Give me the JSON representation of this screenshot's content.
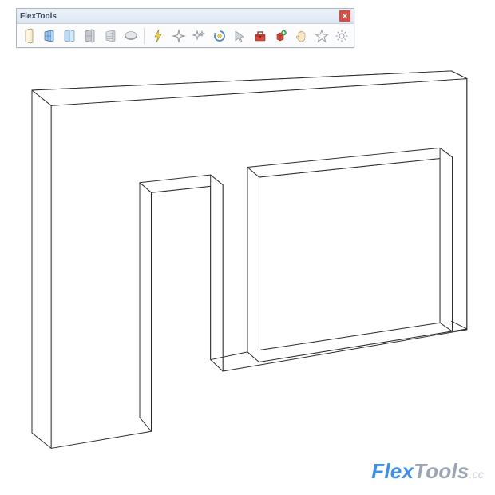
{
  "toolbar": {
    "title": "FlexTools",
    "icons": [
      {
        "name": "door-icon"
      },
      {
        "name": "window-icon"
      },
      {
        "name": "sliding-door-icon"
      },
      {
        "name": "glass-wall-icon"
      },
      {
        "name": "garage-door-icon"
      },
      {
        "name": "cylinder-icon"
      },
      {
        "name": "lightning-icon"
      },
      {
        "name": "sparkle-icon"
      },
      {
        "name": "sparkle-plus-icon"
      },
      {
        "name": "refresh-icon"
      },
      {
        "name": "cursor-icon"
      },
      {
        "name": "toolbox-icon"
      },
      {
        "name": "cube-plus-icon"
      },
      {
        "name": "hand-icon"
      },
      {
        "name": "star-icon"
      },
      {
        "name": "gear-icon"
      }
    ]
  },
  "watermark": {
    "flex": "Flex",
    "tools": "Tools",
    "cc": ".cc"
  }
}
